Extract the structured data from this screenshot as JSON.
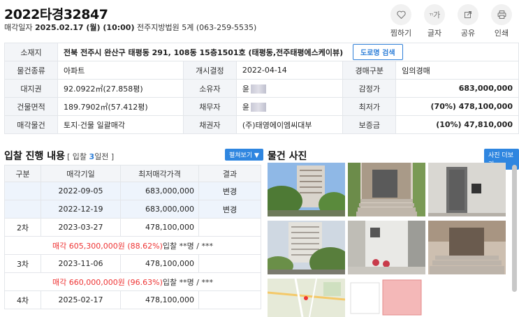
{
  "header": {
    "case_number": "2022타경32847",
    "sale_date_label": "매각일자",
    "sale_date": "2025.02.17 (월) (10:00)",
    "court": "전주지방법원 5계 (063-259-5535)"
  },
  "actions": [
    {
      "name": "favorite",
      "label": "찜하기",
      "icon": "heart-icon",
      "glyph": "♡"
    },
    {
      "name": "font-size",
      "label": "글자",
      "icon": "font-size-icon",
      "glyph": "가"
    },
    {
      "name": "share",
      "label": "공유",
      "icon": "share-icon",
      "glyph": "↗"
    },
    {
      "name": "print",
      "label": "인쇄",
      "icon": "printer-icon",
      "glyph": "⎙"
    }
  ],
  "info": {
    "location_label": "소재지",
    "location_value": "전북 전주시 완산구 태평동 291, 108동 15층1501호 (태평동,전주태평에스케이뷰)",
    "road_button": "도로명 검색",
    "rows": [
      [
        {
          "h": "물건종류",
          "v": "아파트"
        },
        {
          "h": "개시결정",
          "v": "2022-04-14"
        },
        {
          "h": "경매구분",
          "v": "임의경매"
        }
      ],
      [
        {
          "h": "대지권",
          "v": "92.0922㎡(27.858평)"
        },
        {
          "h": "소유자",
          "v": "윤"
        },
        {
          "h": "감정가",
          "v": "683,000,000"
        }
      ],
      [
        {
          "h": "건물면적",
          "v": "189.7902㎡(57.412평)"
        },
        {
          "h": "채무자",
          "v": "윤"
        },
        {
          "h": "최저가",
          "v": "(70%) 478,100,000"
        }
      ],
      [
        {
          "h": "매각물건",
          "v": "토지·건물 일괄매각"
        },
        {
          "h": "채권자",
          "v": "(주)태영에이엠씨대부"
        },
        {
          "h": "보증금",
          "v": "(10%) 47,810,000"
        }
      ]
    ]
  },
  "bid_section": {
    "title": "입찰 진행 내용",
    "note_prefix": "[ 입찰 ",
    "note_count": "3",
    "note_suffix": "일전 ]",
    "toggle_label": "펼쳐보기 ▼",
    "columns": [
      "구분",
      "매각기일",
      "최저매각가격",
      "결과"
    ],
    "rows": [
      {
        "type": "row",
        "round": "",
        "date": "2022-09-05",
        "price": "683,000,000",
        "result": "변경",
        "hl": true
      },
      {
        "type": "row",
        "round": "",
        "date": "2022-12-19",
        "price": "683,000,000",
        "result": "변경",
        "hl": true
      },
      {
        "type": "row",
        "round": "2차",
        "date": "2023-03-27",
        "price": "478,100,000",
        "result": "",
        "hl": false
      },
      {
        "type": "sale",
        "red": "매각 605,300,000원 (88.62%)",
        "rest": "입찰 **명 / ***"
      },
      {
        "type": "row",
        "round": "3차",
        "date": "2023-11-06",
        "price": "478,100,000",
        "result": "",
        "hl": false
      },
      {
        "type": "sale",
        "red": "매각 660,000,000원 (96.63%)",
        "rest": "입찰 **명 / ***"
      },
      {
        "type": "row",
        "round": "4차",
        "date": "2025-02-17",
        "price": "478,100,000",
        "result": "",
        "hl": false
      }
    ]
  },
  "photo_section": {
    "title": "물건 사진",
    "more_label": "사진 더보기"
  },
  "colors": {
    "accent": "#2f86e0",
    "red": "#e33",
    "header_bg": "#f3f5f8",
    "highlight_row": "#eef4fc"
  }
}
